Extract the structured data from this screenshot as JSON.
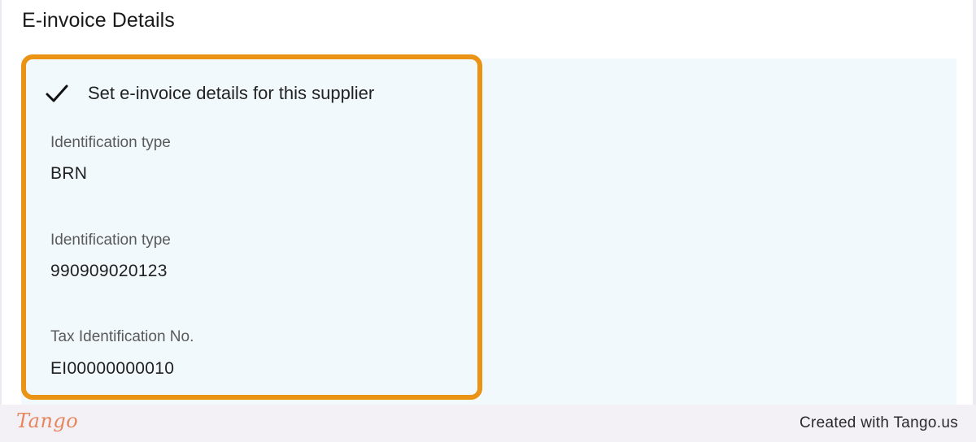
{
  "section": {
    "title": "E-invoice Details"
  },
  "checkbox": {
    "label": "Set e-invoice details for this supplier",
    "checked": true,
    "icon": "check-icon"
  },
  "fields": [
    {
      "label": "Identification type",
      "value": "BRN"
    },
    {
      "label": "Identification type",
      "value": "990909020123"
    },
    {
      "label": "Tax Identification No.",
      "value": "EI00000000010"
    }
  ],
  "footer": {
    "logo": "Tango",
    "credit": "Created with Tango.us"
  },
  "colors": {
    "highlight": "#ea9315",
    "panel_tint": "#f1f9fd",
    "logo": "#e6865f"
  }
}
